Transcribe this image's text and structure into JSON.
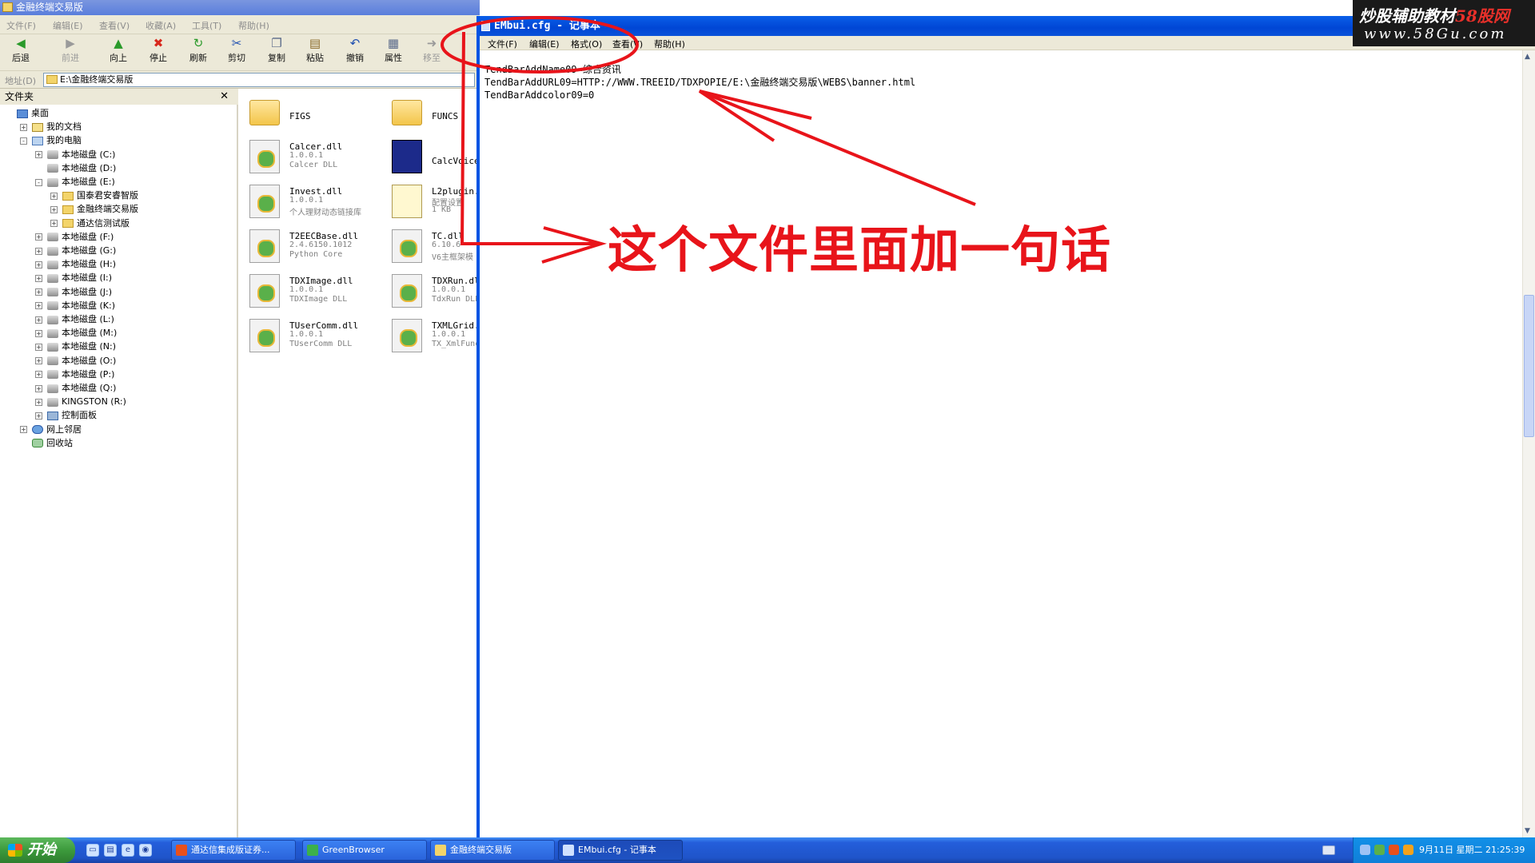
{
  "explorer": {
    "title": "金融终端交易版",
    "menu": [
      "文件(F)",
      "编辑(E)",
      "查看(V)",
      "收藏(A)",
      "工具(T)",
      "帮助(H)"
    ],
    "toolbar": [
      {
        "label": "后退",
        "icon": "back-icon",
        "disabled": false
      },
      {
        "label": "前进",
        "icon": "forward-icon",
        "disabled": true
      },
      {
        "label": "向上",
        "icon": "up-icon",
        "disabled": false
      },
      {
        "label": "停止",
        "icon": "stop-icon",
        "disabled": false
      },
      {
        "label": "刷新",
        "icon": "refresh-icon",
        "disabled": false
      },
      {
        "label": "剪切",
        "icon": "cut-icon",
        "disabled": false
      },
      {
        "label": "复制",
        "icon": "copy-icon",
        "disabled": false
      },
      {
        "label": "粘贴",
        "icon": "paste-icon",
        "disabled": false
      },
      {
        "label": "撤销",
        "icon": "undo-icon",
        "disabled": false
      },
      {
        "label": "属性",
        "icon": "properties-icon",
        "disabled": false
      },
      {
        "label": "移至",
        "icon": "move-to-icon",
        "disabled": true
      }
    ],
    "address_label": "地址(D)",
    "address_value": "E:\\金融终端交易版",
    "folder_pane_title": "文件夹",
    "tree": [
      {
        "label": "桌面",
        "indent": 0,
        "expander": "",
        "icon": "desktop"
      },
      {
        "label": "我的文档",
        "indent": 1,
        "expander": "+",
        "icon": "doc"
      },
      {
        "label": "我的电脑",
        "indent": 1,
        "expander": "-",
        "icon": "pc"
      },
      {
        "label": "本地磁盘 (C:)",
        "indent": 2,
        "expander": "+",
        "icon": "drive"
      },
      {
        "label": "本地磁盘 (D:)",
        "indent": 2,
        "expander": "",
        "icon": "drive"
      },
      {
        "label": "本地磁盘 (E:)",
        "indent": 2,
        "expander": "-",
        "icon": "drive"
      },
      {
        "label": "国泰君安睿智版",
        "indent": 3,
        "expander": "+",
        "icon": "folder"
      },
      {
        "label": "金融终端交易版",
        "indent": 3,
        "expander": "+",
        "icon": "folder"
      },
      {
        "label": "通达信测试版",
        "indent": 3,
        "expander": "+",
        "icon": "folder"
      },
      {
        "label": "本地磁盘 (F:)",
        "indent": 2,
        "expander": "+",
        "icon": "drive"
      },
      {
        "label": "本地磁盘 (G:)",
        "indent": 2,
        "expander": "+",
        "icon": "drive"
      },
      {
        "label": "本地磁盘 (H:)",
        "indent": 2,
        "expander": "+",
        "icon": "drive"
      },
      {
        "label": "本地磁盘 (I:)",
        "indent": 2,
        "expander": "+",
        "icon": "drive"
      },
      {
        "label": "本地磁盘 (J:)",
        "indent": 2,
        "expander": "+",
        "icon": "drive"
      },
      {
        "label": "本地磁盘 (K:)",
        "indent": 2,
        "expander": "+",
        "icon": "drive"
      },
      {
        "label": "本地磁盘 (L:)",
        "indent": 2,
        "expander": "+",
        "icon": "drive"
      },
      {
        "label": "本地磁盘 (M:)",
        "indent": 2,
        "expander": "+",
        "icon": "drive"
      },
      {
        "label": "本地磁盘 (N:)",
        "indent": 2,
        "expander": "+",
        "icon": "drive"
      },
      {
        "label": "本地磁盘 (O:)",
        "indent": 2,
        "expander": "+",
        "icon": "drive"
      },
      {
        "label": "本地磁盘 (P:)",
        "indent": 2,
        "expander": "+",
        "icon": "drive"
      },
      {
        "label": "本地磁盘 (Q:)",
        "indent": 2,
        "expander": "+",
        "icon": "drive"
      },
      {
        "label": "KINGSTON (R:)",
        "indent": 2,
        "expander": "+",
        "icon": "drive"
      },
      {
        "label": "控制面板",
        "indent": 2,
        "expander": "+",
        "icon": "cp"
      },
      {
        "label": "网上邻居",
        "indent": 1,
        "expander": "+",
        "icon": "net"
      },
      {
        "label": "回收站",
        "indent": 1,
        "expander": "",
        "icon": "bin"
      }
    ],
    "files": [
      {
        "name": "FIGS",
        "type": "folder"
      },
      {
        "name": "FUNCS",
        "type": "folder"
      },
      {
        "name": "Calcer.dll",
        "ver": "1.0.0.1",
        "desc": "Calcer DLL",
        "type": "dll"
      },
      {
        "name": "CalcVoice.",
        "type": "app"
      },
      {
        "name": "Invest.dll",
        "ver": "1.0.0.1",
        "desc": "个人理财动态链接库",
        "type": "dll"
      },
      {
        "name": "L2plugin.c",
        "ver": "配置设置",
        "desc": "1 KB",
        "type": "cfg"
      },
      {
        "name": "T2EECBase.dll",
        "ver": "2.4.6150.1012",
        "desc": "Python Core",
        "type": "dll"
      },
      {
        "name": "TC.dll",
        "ver": "6.10.6",
        "desc": "V6主框架模",
        "type": "dll"
      },
      {
        "name": "TDXImage.dll",
        "ver": "1.0.0.1",
        "desc": "TDXImage DLL",
        "type": "dll"
      },
      {
        "name": "TDXRun.dll",
        "ver": "1.0.0.1",
        "desc": "TdxRun DLL",
        "type": "dll"
      },
      {
        "name": "TUserComm.dll",
        "ver": "1.0.0.1",
        "desc": "TUserComm DLL",
        "type": "dll"
      },
      {
        "name": "TXMLGrid.d",
        "ver": "1.0.0.1",
        "desc": "TX_XmlFunc",
        "type": "dll"
      }
    ]
  },
  "notepad": {
    "title": "EMbui.cfg - 记事本",
    "menu": [
      "文件(F)",
      "编辑(E)",
      "格式(O)",
      "查看(V)",
      "帮助(H)"
    ],
    "lines": [
      "TendBarAddName09=综合资讯",
      "TendBarAddURL09=HTTP://WWW.TREEID/TDXPOPIE/E:\\金融终端交易版\\WEBS\\banner.html",
      "TendBarAddcolor09=0"
    ]
  },
  "watermark": {
    "line1_main": "炒股辅助教材",
    "line1_red": "58股网",
    "line2": "www.58Gu.com"
  },
  "annotation": {
    "text": "这个文件里面加一句话",
    "color": "#e8141a"
  },
  "taskbar": {
    "start_label": "开始",
    "tasks": [
      {
        "label": "通达信集成版证券...",
        "active": false,
        "color": "#e8501c"
      },
      {
        "label": "GreenBrowser",
        "active": false,
        "color": "#3cb04a"
      },
      {
        "label": "金融终端交易版",
        "active": false,
        "color": "#f3d46a"
      },
      {
        "label": "EMbui.cfg - 记事本",
        "active": true,
        "color": "#cfe0ff"
      }
    ],
    "clock": "9月11日 星期二 21:25:39"
  }
}
